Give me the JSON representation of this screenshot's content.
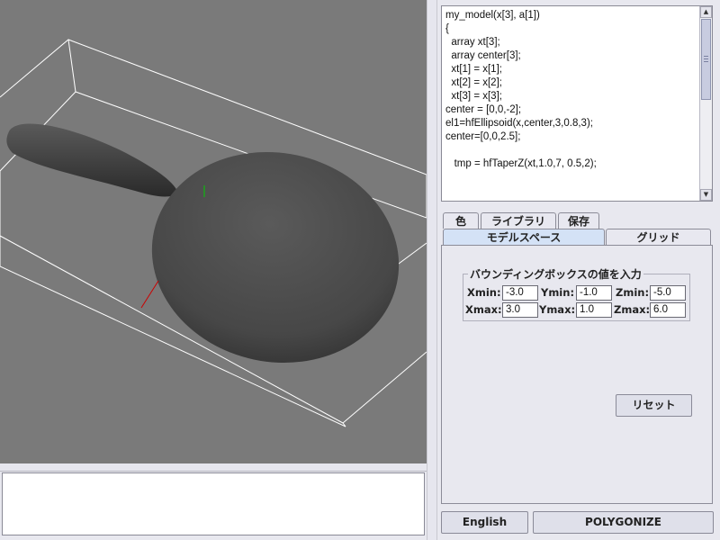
{
  "viewport": {
    "background": "#7a7a7a",
    "shape_color": "#4a4a4a",
    "box_line_color": "#ffffff",
    "axis_y_color": "#00cc00",
    "axis_x_color": "#cc0000"
  },
  "code": {
    "lines": [
      "my_model(x[3], a[1])",
      "{",
      "  array xt[3];",
      "  array center[3];",
      "  xt[1] = x[1];",
      "  xt[2] = x[2];",
      "  xt[3] = x[3];",
      "center = [0,0,-2];",
      "el1=hfEllipsoid(x,center,3,0.8,3);",
      "center=[0,0,2.5];",
      "",
      "   tmp = hfTaperZ(xt,1.0,7, 0.5,2);"
    ]
  },
  "tabs": {
    "top_row": [
      "色",
      "ライブラリ",
      "保存"
    ],
    "bottom_row": [
      "モデルスペース",
      "グリッド"
    ],
    "selected": "モデルスペース"
  },
  "bounding_box": {
    "legend": "バウンディングボックスの値を入力",
    "xmin_label": "Xmin:",
    "xmin": "-3.0",
    "ymin_label": "Ymin:",
    "ymin": "-1.0",
    "zmin_label": "Zmin:",
    "zmin": "-5.0",
    "xmax_label": "Xmax:",
    "xmax": "3.0",
    "ymax_label": "Ymax:",
    "ymax": "1.0",
    "zmax_label": "Zmax:",
    "zmax": "6.0"
  },
  "buttons": {
    "reset": "リセット",
    "language": "English",
    "polygonize": "POLYGONIZE"
  },
  "console": {
    "text": ""
  }
}
